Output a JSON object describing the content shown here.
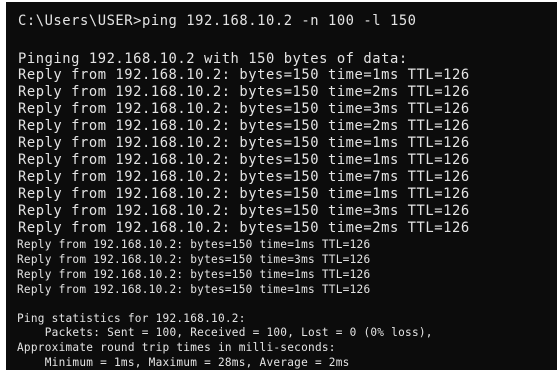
{
  "terminal": {
    "command": "C:\\Users\\USER>ping 192.168.10.2 -n 100 -l 150",
    "pinging": "Pinging 192.168.10.2 with 150 bytes of data:",
    "large_replies": [
      "Reply from 192.168.10.2: bytes=150 time=1ms TTL=126",
      "Reply from 192.168.10.2: bytes=150 time=2ms TTL=126",
      "Reply from 192.168.10.2: bytes=150 time=3ms TTL=126",
      "Reply from 192.168.10.2: bytes=150 time=2ms TTL=126",
      "Reply from 192.168.10.2: bytes=150 time=1ms TTL=126",
      "Reply from 192.168.10.2: bytes=150 time=1ms TTL=126",
      "Reply from 192.168.10.2: bytes=150 time=7ms TTL=126",
      "Reply from 192.168.10.2: bytes=150 time=1ms TTL=126",
      "Reply from 192.168.10.2: bytes=150 time=3ms TTL=126",
      "Reply from 192.168.10.2: bytes=150 time=2ms TTL=126"
    ],
    "small_replies": [
      "Reply from 192.168.10.2: bytes=150 time=1ms TTL=126",
      "Reply from 192.168.10.2: bytes=150 time=3ms TTL=126",
      "Reply from 192.168.10.2: bytes=150 time=1ms TTL=126",
      "Reply from 192.168.10.2: bytes=150 time=1ms TTL=126"
    ],
    "stats_header": "Ping statistics for 192.168.10.2:",
    "packets": "    Packets: Sent = 100, Received = 100, Lost = 0 (0% loss),",
    "approx": "Approximate round trip times in milli-seconds:",
    "times": "    Minimum = 1ms, Maximum = 28ms, Average = 2ms"
  }
}
